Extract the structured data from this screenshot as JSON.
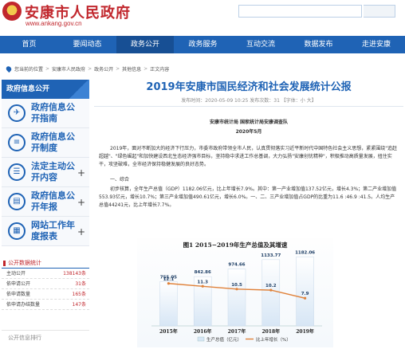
{
  "header": {
    "site_title": "安康市人民政府",
    "site_url": "www.ankang.gov.cn"
  },
  "nav": {
    "items": [
      {
        "label": "首页",
        "active": false
      },
      {
        "label": "要闻动态",
        "active": false
      },
      {
        "label": "政务公开",
        "active": true
      },
      {
        "label": "政务服务",
        "active": false
      },
      {
        "label": "互动交流",
        "active": false
      },
      {
        "label": "数据发布",
        "active": false
      },
      {
        "label": "走进安康",
        "active": false
      }
    ]
  },
  "breadcrumb": {
    "items": [
      "您当前的位置",
      "安康市人民政府",
      "政务公开",
      "其他信息",
      "正文内容"
    ]
  },
  "sidebar": {
    "head": "政府信息公开",
    "items": [
      {
        "label": "政府信息公开指南",
        "icon": "compass-icon",
        "glyph": "✈",
        "plus": false
      },
      {
        "label": "政府信息公开制度",
        "icon": "document-icon",
        "glyph": "≡",
        "plus": false
      },
      {
        "label": "法定主动公开内容",
        "icon": "list-icon",
        "glyph": "☰",
        "plus": true
      },
      {
        "label": "政府信息公开年报",
        "icon": "report-icon",
        "glyph": "▤",
        "plus": true
      },
      {
        "label": "网站工作年度报表",
        "icon": "table-icon",
        "glyph": "▦",
        "plus": true
      }
    ]
  },
  "stats": {
    "head": "公开数据统计",
    "rows": [
      {
        "label": "主动公开",
        "value": "138143条"
      },
      {
        "label": "依申请公开",
        "value": "31条"
      },
      {
        "label": "依申请数量",
        "value": "165条"
      },
      {
        "label": "依申请办结数量",
        "value": "147条"
      }
    ],
    "more": "公开信息排行"
  },
  "article": {
    "title": "2019年安康市国民经济和社会发展统计公报",
    "meta": "发布时间：2020-05-09 10:25  发布次数：31  【字体：小 大】",
    "author": "安康市统计局  国家统计局安康调查队",
    "date": "2020年5月",
    "intro": "2019年，面对不断加大的经济下行压力，市委市政府带领全市人民，认真贯彻落实习近平新时代中国特色社会主义思想，紧紧围绕\"追赶超越\"、\"绿色崛起\"和加快建设西北生态经济强市目标，坚持稳中求进工作总基调，大力弘扬\"安康创优精神\"，积极推动高质量发展，扭住实干，攻坚破难，全市经济保持稳健发展的良好态势。",
    "section": "一、综合",
    "para1": "初步核算，全年生产总值（GDP）1182.06亿元，比上年增长7.9%。其中：第一产业增加值137.52亿元，增长4.3%；第二产业增加值553.93亿元，增长10.7%；第三产业增加值490.61亿元，增长6.0%。一、二、三产业增加值占GDP的比重为11.6 :46.9 :41.5。人均生产总值44241元，比上年增长7.7%。"
  },
  "chart_data": {
    "type": "bar",
    "title": "图1  2015−2019年生产总值及其增速",
    "categories": [
      "2015年",
      "2016年",
      "2017年",
      "2018年",
      "2019年"
    ],
    "series": [
      {
        "name": "生产总值（亿元）",
        "type": "bar",
        "values": [
          755.05,
          842.86,
          974.66,
          1133.77,
          1182.06
        ]
      },
      {
        "name": "比上年增长（%）",
        "type": "line",
        "values": [
          12.1,
          11.3,
          10.5,
          10.2,
          7.9
        ]
      }
    ],
    "ylim": [
      0,
      1200
    ],
    "y2lim": [
      0,
      20
    ],
    "legend": "bottom",
    "colors": {
      "bar": "#d7e6f5",
      "bar_top": "#ffffff",
      "line": "#e0823a"
    }
  }
}
